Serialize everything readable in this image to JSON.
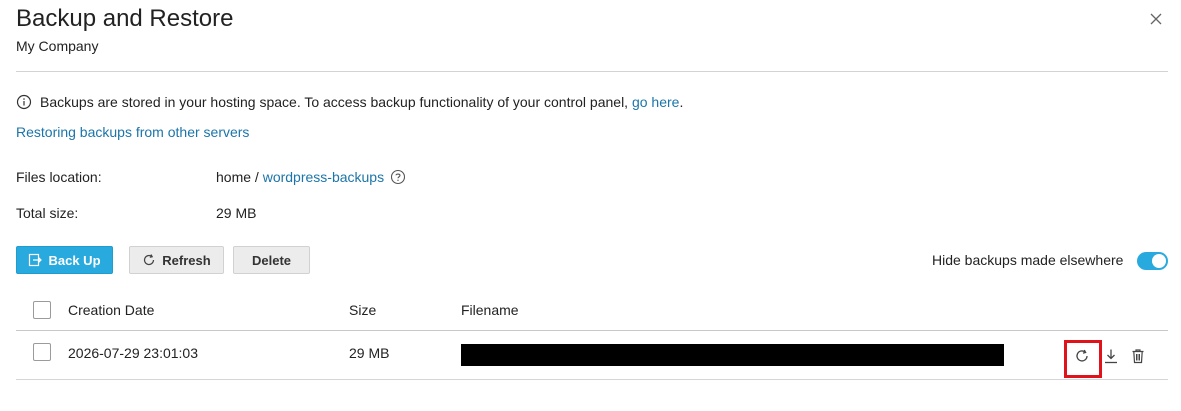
{
  "header": {
    "title": "Backup and Restore",
    "subtitle": "My Company"
  },
  "info": {
    "message": "Backups are stored in your hosting space. To access backup functionality of your control panel,",
    "link_text": "go here",
    "trailing": "."
  },
  "restore_link": "Restoring backups from other servers",
  "details": {
    "files_location_label": "Files location:",
    "path_root": "home",
    "path_separator": " / ",
    "path_folder": "wordpress-backups",
    "total_size_label": "Total size:",
    "total_size_value": "29 MB"
  },
  "toolbar": {
    "backup_label": "Back Up",
    "refresh_label": "Refresh",
    "delete_label": "Delete",
    "toggle_label": "Hide backups made elsewhere",
    "toggle_on": true
  },
  "table": {
    "columns": {
      "creation_date": "Creation Date",
      "size": "Size",
      "filename": "Filename"
    },
    "rows": [
      {
        "creation_date": "2026-07-29 23:01:03",
        "size": "29 MB",
        "filename_redacted": true
      }
    ]
  },
  "colors": {
    "accent": "#28aade",
    "link": "#1b75a9",
    "highlight": "#e0131a"
  },
  "icons": [
    "info-icon",
    "close-icon",
    "help-icon",
    "backup-icon",
    "refresh-icon",
    "restore-icon",
    "download-icon",
    "trash-icon"
  ]
}
